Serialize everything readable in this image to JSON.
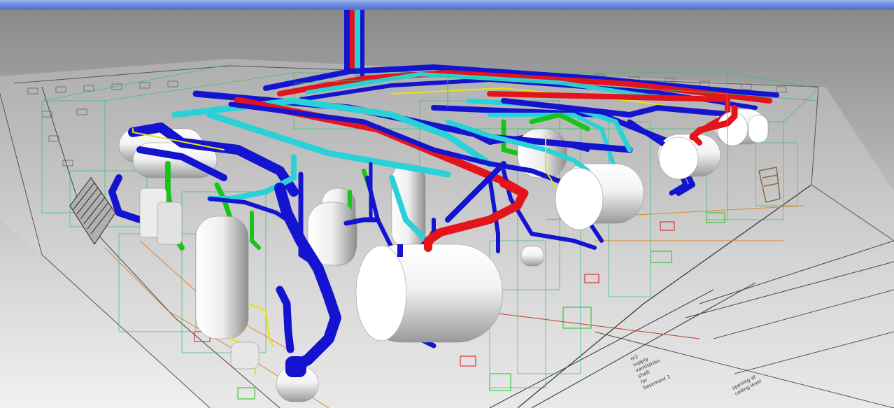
{
  "window": {
    "titlebar_color": "#6e8fe0"
  },
  "scene": {
    "background_top": "#8a8a8a",
    "background_bottom": "#f1f1f1",
    "pipe_colors": {
      "supply_red": "#e3141b",
      "return_blue": "#1414d0",
      "chilled_cyan": "#2ad2d8",
      "condensate_green": "#19c419",
      "gas_yellow": "#e8e21a"
    },
    "floor_notes": {
      "note_1": [
        "m2",
        "supply",
        "ventilation",
        "shaft",
        "for",
        "basement 1"
      ],
      "note_2": [
        "opening at",
        "ceiling level"
      ]
    }
  }
}
